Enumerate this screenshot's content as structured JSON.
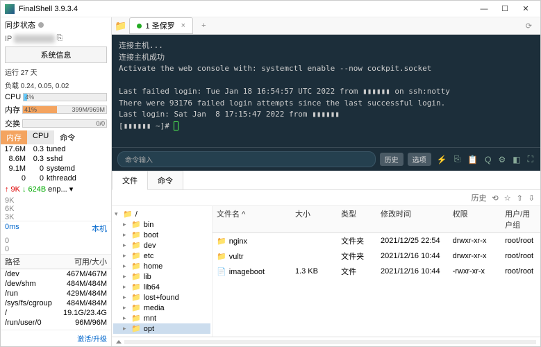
{
  "app": {
    "title": "FinalShell 3.9.3.4"
  },
  "window": {
    "min": "—",
    "max": "☐",
    "close": "✕"
  },
  "sidebar": {
    "sync": "同步状态",
    "ip_label": "IP",
    "sysinfo_btn": "系统信息",
    "uptime": "运行 27 天",
    "load": "负载 0.24, 0.05, 0.02",
    "cpu_label": "CPU",
    "cpu_pct": "4%",
    "mem_label": "内存",
    "mem_pct": "41%",
    "mem_txt": "399M/969M",
    "swap_label": "交换",
    "swap_txt": "0/0",
    "tabs": {
      "mem": "内存",
      "cpu": "CPU",
      "cmd": "命令"
    },
    "procs": [
      {
        "m": "17.6M",
        "c": "0.3",
        "n": "tuned"
      },
      {
        "m": "8.6M",
        "c": "0.3",
        "n": "sshd"
      },
      {
        "m": "9.1M",
        "c": "0",
        "n": "systemd"
      },
      {
        "m": "0",
        "c": "0",
        "n": "kthreadd"
      }
    ],
    "net": {
      "up_arrow": "↑",
      "up": "9K",
      "down_arrow": "↓",
      "down": "624B",
      "iface": "enp...",
      "chev": "▾"
    },
    "graph_ticks": [
      "9K",
      "6K",
      "3K"
    ],
    "ping": {
      "ms": "0ms",
      "host": "本机",
      "v1": "0",
      "v2": "0"
    },
    "paths_hdr": {
      "path": "路径",
      "size": "可用/大小"
    },
    "paths": [
      {
        "p": "/dev",
        "s": "467M/467M"
      },
      {
        "p": "/dev/shm",
        "s": "484M/484M"
      },
      {
        "p": "/run",
        "s": "429M/484M"
      },
      {
        "p": "/sys/fs/cgroup",
        "s": "484M/484M"
      },
      {
        "p": "/",
        "s": "19.1G/23.4G"
      },
      {
        "p": "/run/user/0",
        "s": "96M/96M"
      }
    ],
    "activate": "激活/升级"
  },
  "tab": {
    "name": "1 圣保罗",
    "close": "×",
    "plus": "+",
    "refresh": "⟳"
  },
  "terminal": {
    "lines": [
      "连接主机...",
      "连接主机成功",
      "Activate the web console with: systemctl enable --now cockpit.socket",
      "",
      "Last failed login: Tue Jan 18 16:54:57 UTC 2022 from ▮▮▮▮▮▮ on ssh:notty",
      "There were 93176 failed login attempts since the last successful login.",
      "Last login: Sat Jan  8 17:15:47 2022 from ▮▮▮▮▮▮",
      "[▮▮▮▮▮▮ ~]# "
    ]
  },
  "cmdbar": {
    "placeholder": "命令输入",
    "history": "历史",
    "options": "选项"
  },
  "filetabs": {
    "files": "文件",
    "cmd": "命令"
  },
  "filetools": {
    "history": "历史"
  },
  "tree": [
    {
      "n": "/",
      "exp": "▾",
      "sel": false
    },
    {
      "n": "bin",
      "exp": "▸"
    },
    {
      "n": "boot",
      "exp": "▸"
    },
    {
      "n": "dev",
      "exp": "▸"
    },
    {
      "n": "etc",
      "exp": "▸"
    },
    {
      "n": "home",
      "exp": "▸"
    },
    {
      "n": "lib",
      "exp": "▸"
    },
    {
      "n": "lib64",
      "exp": "▸"
    },
    {
      "n": "lost+found",
      "exp": "▸"
    },
    {
      "n": "media",
      "exp": "▸"
    },
    {
      "n": "mnt",
      "exp": "▸"
    },
    {
      "n": "opt",
      "exp": "▸",
      "sel": true
    }
  ],
  "filehdr": {
    "name": "文件名",
    "size": "大小",
    "type": "类型",
    "mtime": "修改时间",
    "perm": "权限",
    "own": "用户/用户组"
  },
  "files": [
    {
      "icon": "folder",
      "name": "nginx",
      "size": "",
      "type": "文件夹",
      "mtime": "2021/12/25 22:54",
      "perm": "drwxr-xr-x",
      "own": "root/root"
    },
    {
      "icon": "folder",
      "name": "vultr",
      "size": "",
      "type": "文件夹",
      "mtime": "2021/12/16 10:44",
      "perm": "drwxr-xr-x",
      "own": "root/root"
    },
    {
      "icon": "file",
      "name": "imageboot",
      "size": "1.3 KB",
      "type": "文件",
      "mtime": "2021/12/16 10:44",
      "perm": "-rwxr-xr-x",
      "own": "root/root"
    }
  ]
}
